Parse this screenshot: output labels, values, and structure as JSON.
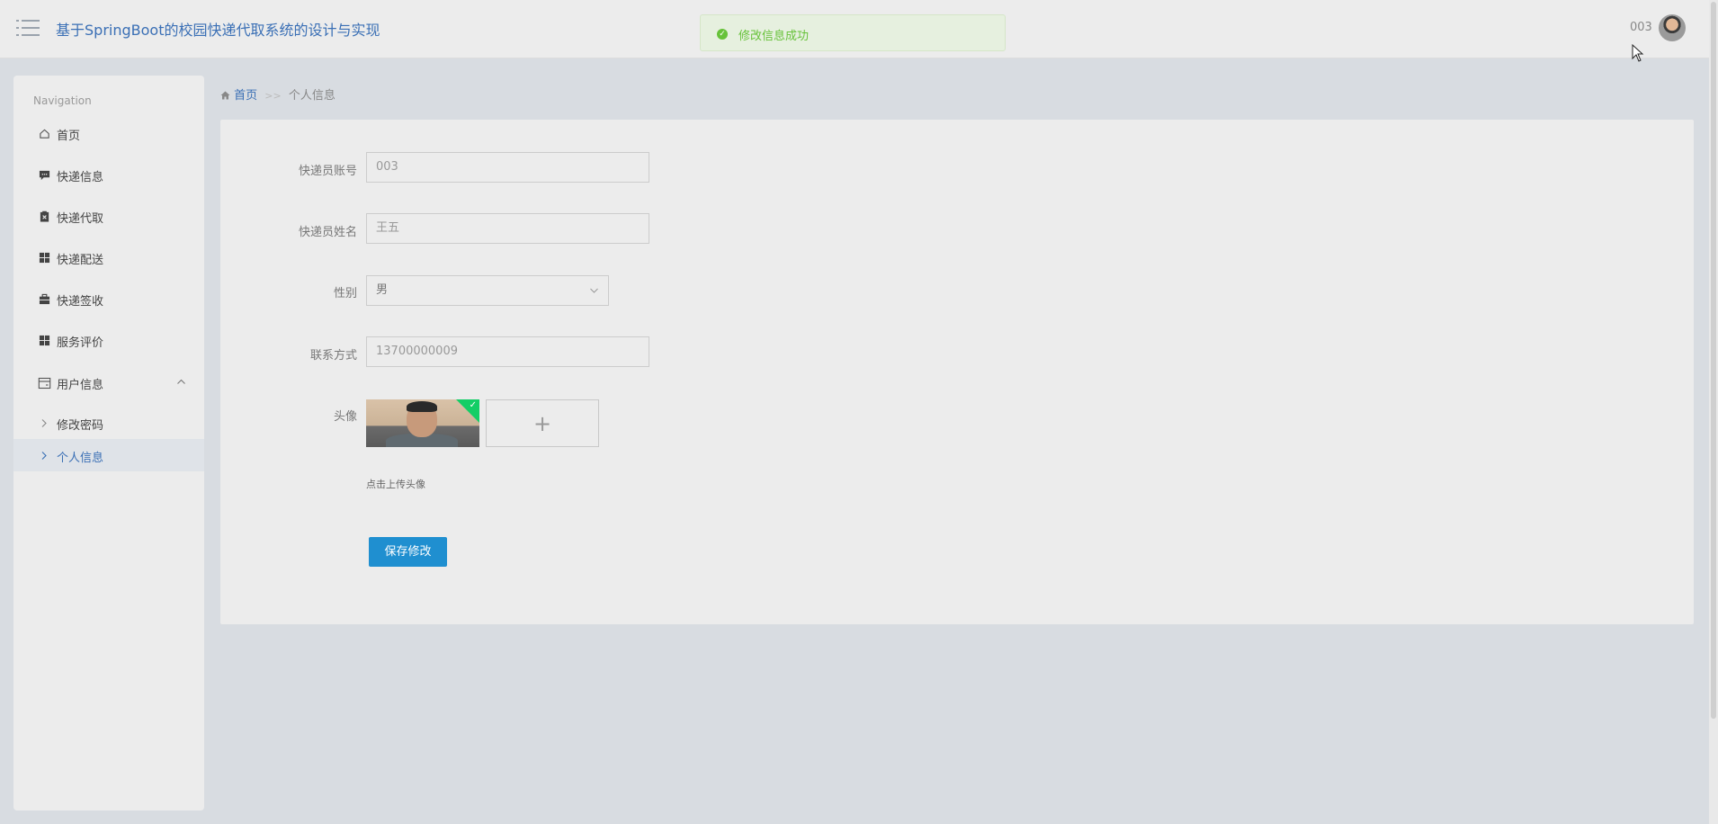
{
  "header": {
    "app_title": "基于SpringBoot的校园快递代取系统的设计与实现",
    "toast_message": "修改信息成功",
    "username": "003"
  },
  "sidebar": {
    "heading": "Navigation",
    "items": [
      {
        "label": "首页",
        "icon": "home-icon"
      },
      {
        "label": "快递信息",
        "icon": "message-icon"
      },
      {
        "label": "快递代取",
        "icon": "clipboard-icon"
      },
      {
        "label": "快递配送",
        "icon": "grid-icon"
      },
      {
        "label": "快递签收",
        "icon": "briefcase-icon"
      },
      {
        "label": "服务评价",
        "icon": "grid-icon"
      },
      {
        "label": "用户信息",
        "icon": "wallet-icon"
      }
    ],
    "sub_items": [
      {
        "label": "修改密码"
      },
      {
        "label": "个人信息",
        "active": true
      }
    ]
  },
  "breadcrumb": {
    "home": "首页",
    "separator": ">>",
    "current": "个人信息"
  },
  "form": {
    "account_label": "快递员账号",
    "account_value": "003",
    "name_label": "快递员姓名",
    "name_value": "王五",
    "gender_label": "性别",
    "gender_value": "男",
    "phone_label": "联系方式",
    "phone_value": "13700000009",
    "avatar_label": "头像",
    "upload_hint": "点击上传头像",
    "save_label": "保存修改"
  },
  "colors": {
    "accent": "#3a6fb5",
    "primary_button": "#1f8fd0",
    "success": "#67c23a",
    "upload_success_badge": "#13ce66"
  }
}
